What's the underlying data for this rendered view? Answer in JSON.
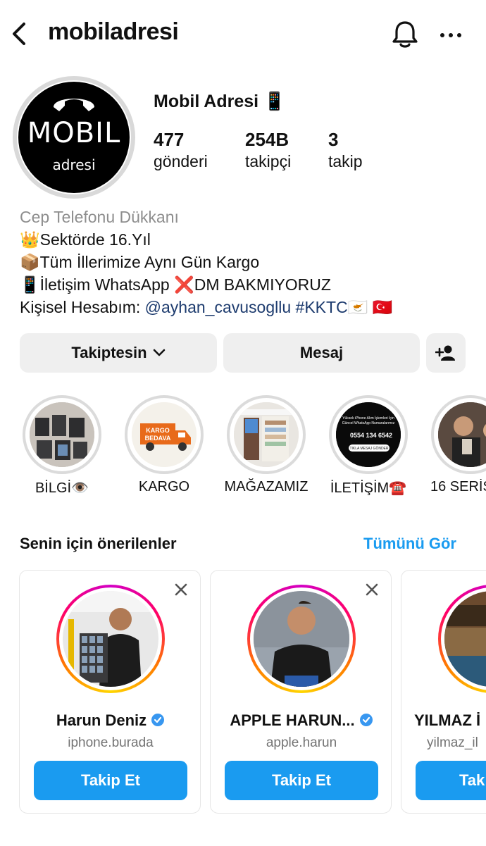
{
  "header": {
    "title": "mobiladresi",
    "icons": [
      "back-arrow-icon",
      "bell-icon",
      "more-icon"
    ]
  },
  "profile": {
    "avatar_text_big": "MOBIL",
    "avatar_text_small": "adresi",
    "display_name": "Mobil Adresi 📱",
    "stats": [
      {
        "value": "477",
        "label": "gönderi"
      },
      {
        "value": "254B",
        "label": "takipçi"
      },
      {
        "value": "3",
        "label": "takip"
      }
    ]
  },
  "bio": {
    "category": "Cep Telefonu Dükkanı",
    "line1": "👑Sektörde 16.Yıl",
    "line2": "📦Tüm İllerimize Aynı Gün Kargo",
    "line3": "📱İletişim WhatsApp ❌DM BAKMIYORUZ",
    "line4_prefix": "Kişisel Hesabım: ",
    "line4_mention": "@ayhan_cavusogllu #KKTC",
    "line4_flags": "🇨🇾 🇹🇷"
  },
  "actions": {
    "follow_label": "Takiptesin",
    "message_label": "Mesaj"
  },
  "highlights": [
    {
      "label": "BİLGİ👁️"
    },
    {
      "label": "KARGO"
    },
    {
      "label": "MAĞAZAMIZ"
    },
    {
      "label": "İLETİŞİM☎️"
    },
    {
      "label": "16 SERİS"
    }
  ],
  "highlight_texts": {
    "kargo_line1": "KARGO",
    "kargo_line2": "BEDAVA",
    "contact_line1": "Yüksek iPhone Alım İşlemleri İçin",
    "contact_line2": "Güncel WhatsApp Numaralarımız",
    "contact_phone": "0554 134 6542",
    "contact_button": "TIKLA MESAJ GÖNDER"
  },
  "suggestions": {
    "title": "Senin için önerilenler",
    "see_all": "Tümünü Gör",
    "cards": [
      {
        "name": "Harun Deniz",
        "username": "iphone.burada",
        "button": "Takip Et",
        "verified": true
      },
      {
        "name": "APPLE HARUN...",
        "username": "apple.harun",
        "button": "Takip Et",
        "verified": true
      },
      {
        "name": "YILMAZ İ",
        "username": "yilmaz_il",
        "button": "Tak",
        "verified": false
      }
    ]
  },
  "colors": {
    "accent_blue": "#1a9bf0",
    "button_gray": "#efefef",
    "muted_text": "#8e8e8e",
    "link": "#1d3b6e"
  }
}
